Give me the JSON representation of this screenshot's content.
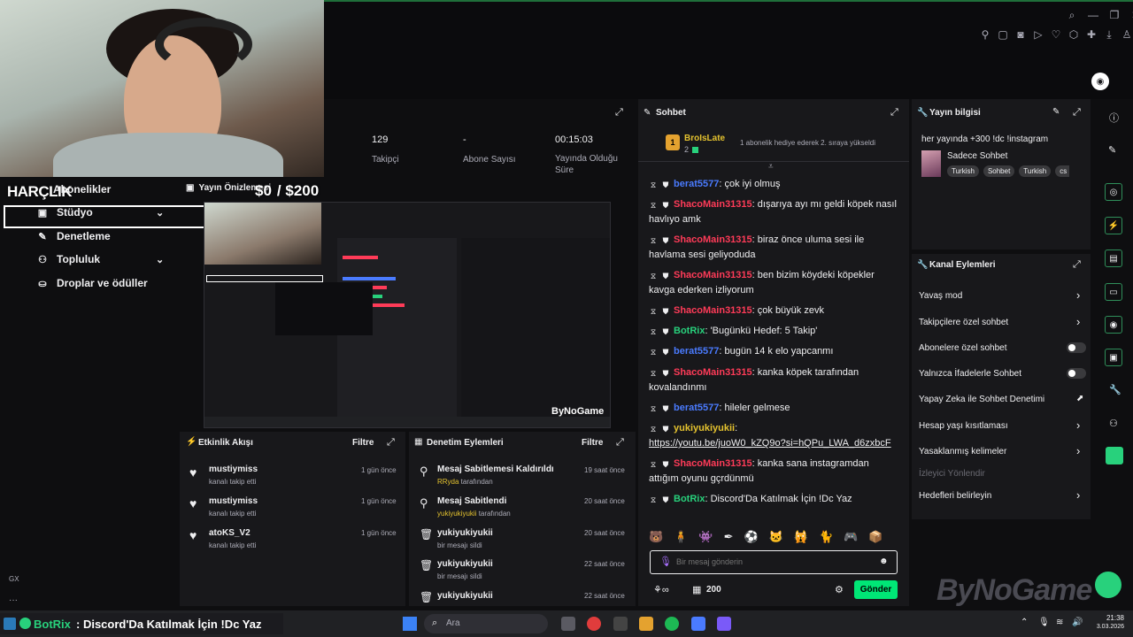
{
  "overlay": {
    "harclik_label": "HARÇLIK",
    "donation_amount": "$0",
    "donation_goal": "/ $200",
    "watermark": "ByNoGame",
    "bottom_ticker_user": "BotRix",
    "bottom_ticker_text": ": Discord'Da Katılmak İçin !Dc Yaz"
  },
  "sidebar": {
    "items": [
      {
        "label": "Abonelikler",
        "icon": "list-icon"
      },
      {
        "label": "Stüdyo",
        "icon": "studio-icon",
        "chevron": true
      },
      {
        "label": "Denetleme",
        "icon": "wrench-icon"
      },
      {
        "label": "Topluluk",
        "icon": "community-icon",
        "chevron": true
      },
      {
        "label": "Droplar ve ödüller",
        "icon": "drops-icon"
      }
    ],
    "preview_label": "Yayın Önizlemesi"
  },
  "stats": {
    "followers_value": "129",
    "followers_label": "Takipçi",
    "subs_value": "-",
    "subs_label": "Abone Sayısı",
    "uptime_value": "00:15:03",
    "uptime_label": "Yayında Olduğu Süre"
  },
  "chat": {
    "title": "Sohbet",
    "pinned_user": "BroIsLate",
    "pinned_level": "2",
    "pinned_text": "1 abonelik hediye ederek 2. sıraya yükseldi",
    "messages": [
      {
        "user": "berat5577",
        "text": ": çok iyi olmuş",
        "color": "blue"
      },
      {
        "user": "ShacoMain31315",
        "text": ": dışarıya ayı mı geldi köpek nasıl havlıyo amk",
        "color": "red"
      },
      {
        "user": "ShacoMain31315",
        "text": ": biraz önce uluma sesi ile havlama sesi geliyoduda",
        "color": "red"
      },
      {
        "user": "ShacoMain31315",
        "text": ": ben bizim köydeki köpekler kavga ederken izliyorum",
        "color": "red"
      },
      {
        "user": "ShacoMain31315",
        "text": ": çok büyük zevk",
        "color": "red"
      },
      {
        "user": "BotRix",
        "text": ": 'Bugünkü Hedef: 5 Takip'",
        "color": "green"
      },
      {
        "user": "berat5577",
        "text": ": bugün 14 k elo yapcanmı",
        "color": "blue"
      },
      {
        "user": "ShacoMain31315",
        "text": ": kanka köpek tarafından kovalandınmı",
        "color": "red"
      },
      {
        "user": "berat5577",
        "text": ": hileler gelmese",
        "color": "blue"
      },
      {
        "user": "yukiyukiyukii",
        "text": ":",
        "link": "https://youtu.be/juoW0_kZQ9o?si=hQPu_LWA_d6zxbcF",
        "color": "yellow"
      },
      {
        "user": "ShacoMain31315",
        "text": ": kanka sana instagramdan attığım oyunu gçrdünmü",
        "color": "red"
      },
      {
        "user": "BotRix",
        "text": ": Discord'Da Katılmak İçin !Dc Yaz",
        "color": "green"
      }
    ],
    "input_placeholder": "Bir mesaj gönderin",
    "points": "200",
    "send_label": "Gönder"
  },
  "stream_info": {
    "title": "Yayın bilgisi",
    "stream_title": "her yayında +300 !dc !instagram",
    "category": "Sadece Sohbet",
    "tags": [
      "Turkish",
      "Sohbet",
      "Turkish",
      "cs"
    ]
  },
  "channel_actions": {
    "title": "Kanal Eylemleri",
    "items": [
      {
        "label": "Yavaş mod",
        "control": "arrow"
      },
      {
        "label": "Takipçilere özel sohbet",
        "control": "arrow"
      },
      {
        "label": "Abonelere özel sohbet",
        "control": "toggle"
      },
      {
        "label": "Yalnızca İfadelerle Sohbet",
        "control": "toggle"
      },
      {
        "label": "Yapay Zeka ile Sohbet Denetimi",
        "control": "external"
      },
      {
        "label": "Hesap yaşı kısıtlaması",
        "control": "arrow"
      },
      {
        "label": "Yasaklanmış kelimeler",
        "control": "arrow"
      },
      {
        "label": "İzleyici Yönlendir",
        "control": "none"
      },
      {
        "label": "Hedefleri belirleyin",
        "control": "arrow"
      }
    ]
  },
  "activity_feed": {
    "title": "Etkinlik Akışı",
    "filter_label": "Filtre",
    "events": [
      {
        "name": "mustiymiss",
        "sub": "kanalı takip etti",
        "time": "1 gün önce"
      },
      {
        "name": "mustiymiss",
        "sub": "kanalı takip etti",
        "time": "1 gün önce"
      },
      {
        "name": "atoKS_V2",
        "sub": "kanalı takip etti",
        "time": "1 gün önce"
      }
    ]
  },
  "moderation": {
    "title": "Denetim Eylemleri",
    "filter_label": "Filtre",
    "events": [
      {
        "name": "Mesaj Sabitlemesi Kaldırıldı",
        "by": "RRyda",
        "sub": " tarafından",
        "time": "19 saat önce",
        "icon": "pin-off-icon"
      },
      {
        "name": "Mesaj Sabitlendi",
        "by": "yukiyukiyukii",
        "sub": " tarafından",
        "time": "20 saat önce",
        "icon": "pin-icon"
      },
      {
        "name": "yukiyukiyukii",
        "by": "",
        "sub": "bir mesajı sildi",
        "time": "20 saat önce",
        "icon": "trash-icon"
      },
      {
        "name": "yukiyukiyukii",
        "by": "",
        "sub": "bir mesajı sildi",
        "time": "22 saat önce",
        "icon": "trash-icon"
      },
      {
        "name": "yukiyukiyukii",
        "by": "",
        "sub": "",
        "time": "22 saat önce",
        "icon": "trash-icon"
      }
    ]
  },
  "taskbar": {
    "search_placeholder": "Ara",
    "time": "21:38",
    "date": "3.03.2026"
  },
  "misc": {
    "gx_label": "GX"
  }
}
